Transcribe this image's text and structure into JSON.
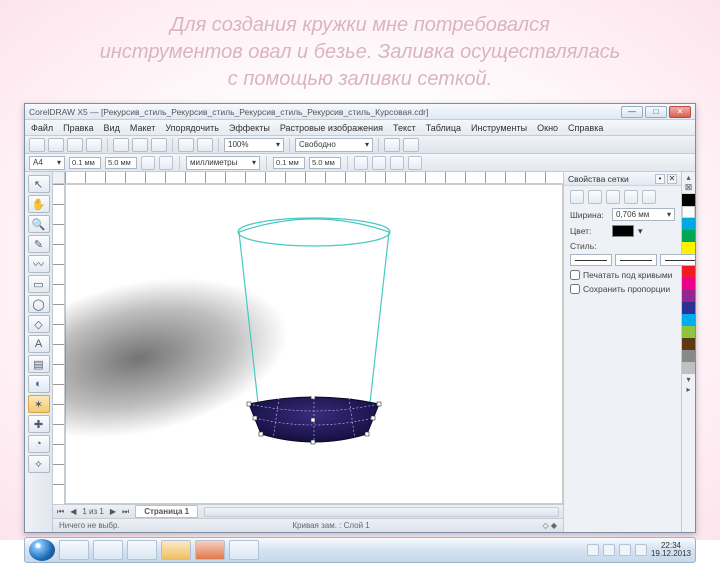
{
  "headline": {
    "line1": "Для создания кружки мне потребовался",
    "line2": "инструментов овал и безье. Заливка осуществлялась",
    "line3": "с помощью заливки сеткой."
  },
  "titlebar": {
    "text": "CorelDRAW X5 — [Рекурсив_стиль_Рекурсив_стиль_Рекурсив_стиль_Рекурсив_стиль_Курсовая.cdr]"
  },
  "menu": {
    "items": [
      "Файл",
      "Правка",
      "Вид",
      "Макет",
      "Упорядочить",
      "Эффекты",
      "Растровые изображения",
      "Текст",
      "Таблица",
      "Инструменты",
      "Окно",
      "Справка"
    ]
  },
  "propbar": {
    "size_combo": "A4",
    "field1": "100%",
    "field2": "100%",
    "units": "миллиметры",
    "snap_combo": "Свободно",
    "misc1": "0.1 мм",
    "misc2": "5.0 мм"
  },
  "toolbox": {
    "tools": [
      "↖",
      "✋",
      "🔍",
      "✎",
      "〰",
      "▭",
      "◯",
      "◇",
      "A",
      "▤",
      "◐",
      "✶",
      "✚",
      "◔",
      "✧"
    ],
    "active_index": 11
  },
  "page": {
    "tab_label": "Страница 1",
    "nav_label": "1 из 1"
  },
  "status": {
    "left": "Ничего не выбр.",
    "center": "Кривая зам. : Слой 1"
  },
  "docker": {
    "title": "Свойства сетки",
    "width_label": "Ширина:",
    "width_value": "0,706 мм",
    "color_label": "Цвет:",
    "style_label": "Стиль:",
    "check1": "Печатать под кривыми",
    "check2": "Сохранить пропорции",
    "arrow_glyph": "▾"
  },
  "palette": {
    "colors": [
      "#000000",
      "#ffffff",
      "#00a9e0",
      "#00a651",
      "#fff200",
      "#f7941d",
      "#ed1c24",
      "#ec008c",
      "#92278f",
      "#2e3192",
      "#00aeef",
      "#8dc63e",
      "#603913",
      "#898989",
      "#c0c0c0"
    ]
  },
  "taskbar": {
    "time": "22:34",
    "date": "19.12.2013"
  }
}
